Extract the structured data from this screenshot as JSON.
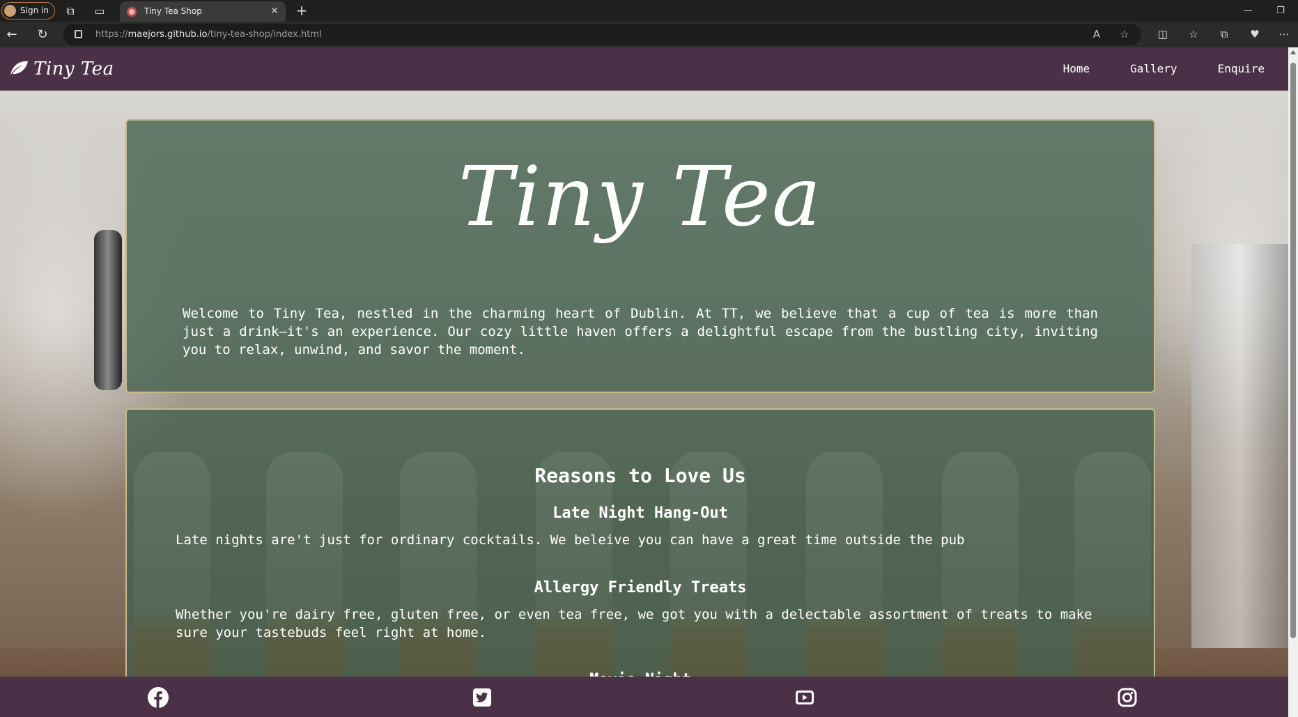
{
  "browser": {
    "sign_in": "Sign in",
    "tab_title": "Tiny Tea Shop",
    "url_prefix": "https://",
    "url_host": "maejors.github.io",
    "url_path": "/tiny-tea-shop/index.html"
  },
  "site": {
    "logo_text": "Tiny Tea",
    "nav": [
      {
        "label": "Home"
      },
      {
        "label": "Gallery"
      },
      {
        "label": "Enquire"
      }
    ],
    "hero": {
      "title": "Tiny Tea",
      "welcome": "Welcome to Tiny Tea, nestled in the charming heart of Dublin. At TT, we believe that a cup of tea is more than just a drink—it's an experience. Our cozy little haven offers a delightful escape from the bustling city, inviting you to relax, unwind, and savor the moment."
    },
    "reasons": {
      "title": "Reasons to Love Us",
      "items": [
        {
          "title": "Late Night Hang-Out",
          "text": "Late nights are't just for ordinary cocktails. We beleive you can have a great time outside the pub"
        },
        {
          "title": "Allergy Friendly Treats",
          "text": "Whether you're dairy free, gluten free, or even tea free, we got you with a delectable assortment of treats to make sure your tastebuds feel right at home."
        },
        {
          "title": "Movie Night",
          "text": ""
        }
      ]
    },
    "footer": {
      "icons": [
        "facebook-icon",
        "twitter-icon",
        "youtube-icon",
        "instagram-icon"
      ]
    }
  },
  "colors": {
    "header": "#4a3147",
    "card": "#42604e",
    "card_border": "#c9b98a"
  }
}
